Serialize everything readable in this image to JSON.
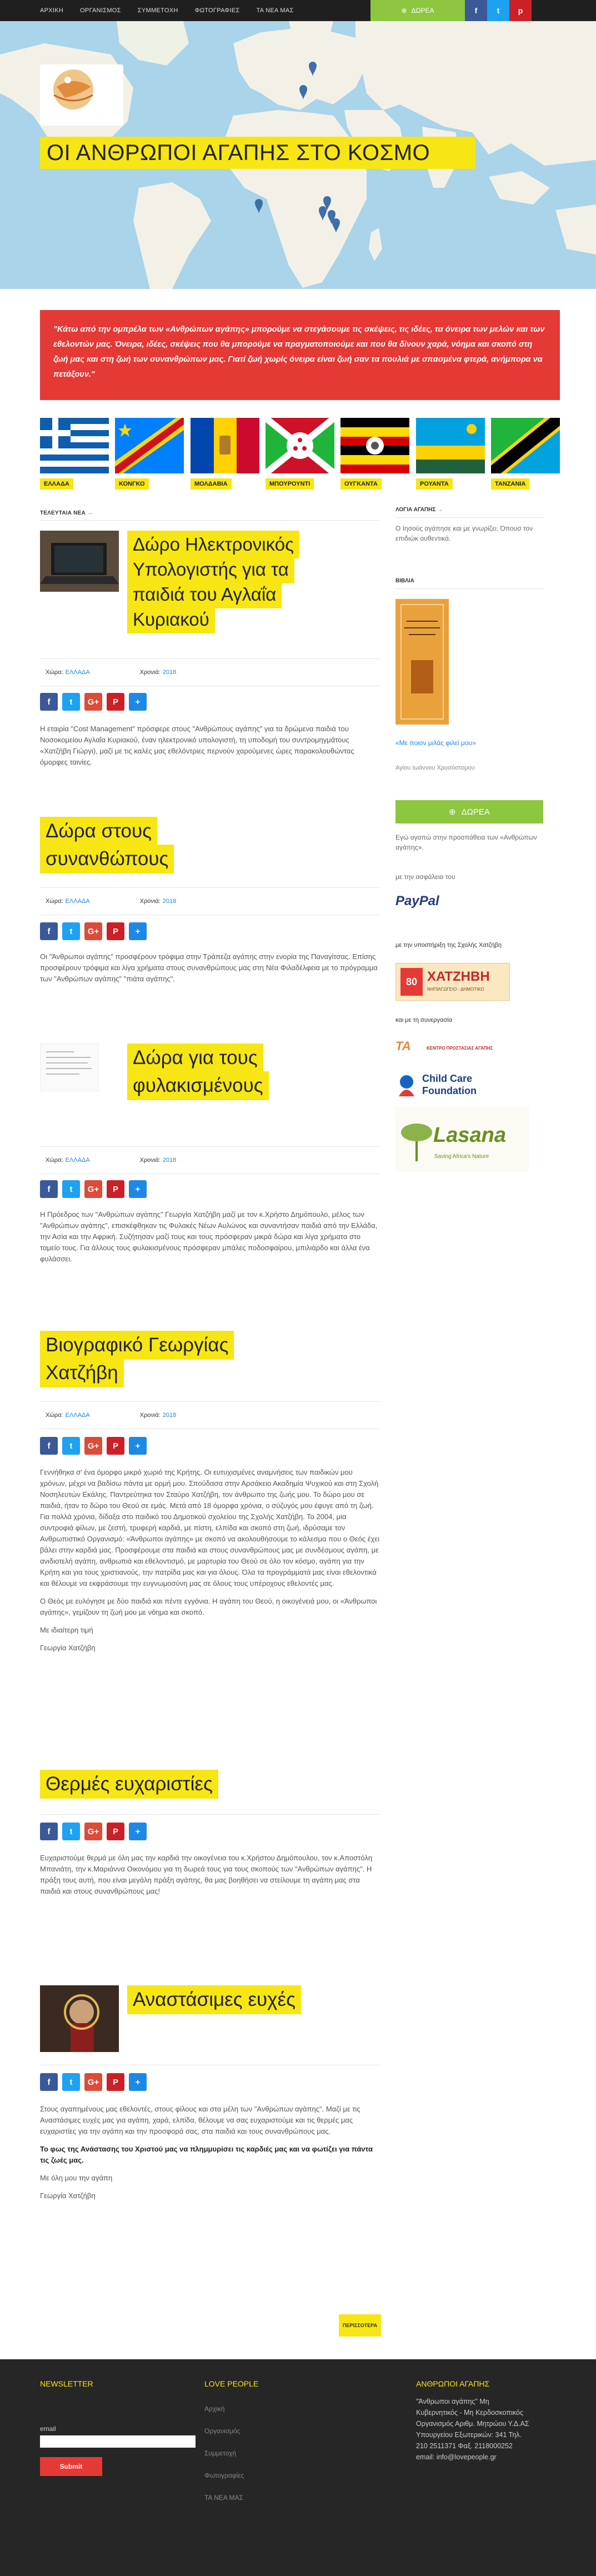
{
  "nav": {
    "items": [
      "ΑΡΧΙΚΗ",
      "ΟΡΓΑΝΙΣΜΟΣ",
      "ΣΥΜΜΕΤΟΧΗ",
      "ΦΩΤΟΓΡΑΦΙΕΣ",
      "ΤΑ ΝΕΑ ΜΑΣ"
    ],
    "donate_label": "ΔΩΡΕΑ"
  },
  "hero": {
    "title": "ΟΙ ΑΝΘΡΩΠΟΙ ΑΓΑΠΗΣ ΣΤΟ ΚΟΣΜΟ"
  },
  "quote": "\"Κάτω από την ομπρέλα των «Ανθρώπων αγάπης» μπορούμε να στεγάσουμε τις σκέψεις, τις ιδέες, τα όνειρα των μελών και των εθελοντών μας. Όνειρα, ιδέες, σκέψεις που θα μπορούμε να πραγματοποιούμε και που θα δίνουν χαρά, νόημα και σκοπό στη ζωή μας και στη ζωή των συνανθρώπων μας. Γιατί ζωή χωρίς όνειρα είναι ζωή σαν τα πουλιά με σπασμένα φτερά, ανήμπορα να πετάξουν.\"",
  "flags": [
    "ΕΛΛΑΔΑ",
    "ΚΟΝΓΚΟ",
    "ΜΟΛΔΑΒΙΑ",
    "ΜΠΟΥΡΟΥΝΤΙ",
    "ΟΥΓΚΑΝΤΑ",
    "ΡΟΥΑΝΤΑ",
    "ΤΑΝΖΑΝΙΑ"
  ],
  "main": {
    "section_title": "ΤΕΛΕΥΤΑΙΑ ΝΕΑ",
    "country_label": "Χώρα:",
    "year_label": "Χρονιά:",
    "posts": [
      {
        "title_lines": [
          "Δώρο Ηλεκτρονικός",
          "Υπολογιστής για τα",
          "παιδιά του Αγλαΐα",
          "Κυριακού"
        ],
        "country": "ΕΛΛΑΔΑ",
        "year": "2018",
        "body": [
          "Η εταιρία \"Cost Management\" πρόσφερε στους \"Ανθρώπους αγάπης\" για τα δρώμενα παιδιά του Νοσοκομείου Αγλαΐα Κυριακού, έναν ηλεκτρονικό υπολογιστή, τη υποδομή του συντρομηγμάτους «Χατζήβη Γιώργι), μαζί με τις καλές μας εθελόντριες περνούν χαρούμενες ώρες παρακολουθώντας όμορφες ταινίες."
        ]
      },
      {
        "title_lines": [
          "Δώρα στους",
          "συνανθώπους"
        ],
        "country": "ΕΛΛΑΔΑ",
        "year": "2018",
        "body": [
          "Οι \"Άνθρωποι αγάπης\" προσφέρουν τρόφιμα στην Τράπεζα αγάπης στην ενορία της Παναγίτσας. Επίσης προσφέρουν τρόφιμα και λίγα χρήματα στους συνανθρώπους μας στη Νέα Φιλαδέλφεια με το πρόγραμμα των \"Ανθρώπων αγάπης\" \"πιάτα αγάπης\"."
        ]
      },
      {
        "title_lines": [
          "Δώρα για τους",
          "φυλακισμένους"
        ],
        "country": "ΕΛΛΑΔΑ",
        "year": "2018",
        "body": [
          "Η Πρόεδρος των \"Ανθρώπων αγάπης\" Γεωργία Χατζήβη μαζί με τον κ.Χρήστο Δημόπουλο, μέλος των \"Ανθρώπων αγάπης\", επισκέφθηκαν τις Φυλακές Νέων Αυλώνος και συναντήσαν παιδιά από την Ελλάδα, την Ασία και την Αφρική. Συζήτησαν μαζί τους και τους πρόσφεραν μικρά δώρα και λίγα χρήματα στο ταμείο τους. Για άλλους τους φυλακισμένους πρόσφεραν μπάλες ποδοσφαίρου, μπιλιάρδο και άλλα ένα φυλάσσει."
        ]
      },
      {
        "title_lines": [
          "Βιογραφικό Γεωργίας",
          "Χατζήβη"
        ],
        "country": "ΕΛΛΑΔΑ",
        "year": "2018",
        "body": [
          "Γεννήθηκα σ' ένα όμορφο μικρό χωριό της Κρήτης. Οι ευτυχισμένες αναμνήσεις των παιδικών μου χρόνων, μέχρι να βαδίσω πάντα με ορμή μου. Σπούδασα στην Αρσάκειο Ακαδημία Ψυχικού και στη Σχολή Νοσηλευτών Εκάλης. Παντρεύτηκα τον Σταύρο Χατζήβη, τον άνθρωπο της ζωής μου. Το δώρο μου σε παιδιά, ήταν το δώρο του Θεού σε εμάς. Μετά από 18 όμορφα χρόνια, ο σύζυγός μου έφυγε από τη ζωή. Για πολλά χρόνια, δίδαξα στο παιδικό του Δημοτικού σχολείου της Σχολής Χατζήβη. Το 2004, μια συντροφιά φίλων, με ζεστή, τρυφερή καρδιά, με πίστη, ελπίδα και σκοπό στη ζωή, ιδρύσαμε τον Ανθρωπιστικό Οργανισμό: «Άνθρωποι αγάπης» με σκοπό να ακολουθήσουμε το κάλεσμα που ο Θεός έχει βάλει στην καρδιά μας. Προσφέρουμε στα παιδιά και στους συνανθρώπους μας με συνδέσμους αγάπη, με ανιδιοτελή αγάπη, ανθρωπιά και εθελοντισμό, με μαρτυρία του Θεού σε όλο τον κόσμο, αγάπη για την Κρήτη και για τους χριστιανούς, την πατρίδα μας και για όλους. Όλα τα προγράμματά μας είναι εθελοντικά και θέλουμε να εκφράσουμε την ευγνωμοσύνη μας σε όλους τους υπέροχους εθελοντές μας.",
          "Ο Θεός με ευλόγησε με δύο παιδιά και πέντε εγγόνια. Η αγάπη του Θεού, η οικογένειά μου, οι «Άνθρωποι αγάπης», γεμίζουν τη ζωή μου με νόημα και σκοπό.",
          "Με ιδιαίτερη τιμή",
          "Γεωργία Χατζήβη"
        ]
      },
      {
        "title_lines": [
          "Θερμές ευχαριστίες"
        ],
        "country": "",
        "year": "",
        "body": [
          "Ευχαριστούμε θερμά με όλη μας την καρδιά την οικογένεια του κ.Χρήστου Δημόπουλου, τον κ.Αποστόλη Μπανιάτη, την κ.Μαριάννα Οικονόμου για τη δωρεά τους για τους σκοπούς των \"Ανθρώπων αγάπης\". Η πράξη τους αυτή, που είναι μεγάλη πράξη αγάπης, θα μας βοηθήσει να στείλουμε τη αγάπη μας στα παιδιά και στους συνανθρώπους μας!"
        ]
      },
      {
        "title_lines": [
          "Αναστάσιμες ευχές"
        ],
        "country": "",
        "year": "",
        "body": [
          "Στους αγαπημένους μας εθελοντές, στους φίλους και στα μέλη των \"Ανθρώπων αγάπης\". Μαζί με τις Αναστάσιμες ευχές μας για αγάπη, χαρά, ελπίδα, θέλουμε να σας ευχαριστούμε και τις θερμές μας ευχαριστίες για την αγάπη και την προσφορά σας, στα παιδιά και τους συνανθρώπους μας.",
          "Το φως της Ανάστασης του Χριστού μας να πλημμυρίσει τις καρδιές μας και να φωτίζει για πάντα τις ζωές μας.",
          "Με όλη μου την αγάπη",
          "Γεωργία Χατζήβη"
        ]
      }
    ],
    "older_label": "ΠΕΡΙΣΣΟΤΕΡΑ"
  },
  "sidebar": {
    "logia_title": "ΛΟΓΙΑ ΑΓΑΠΗΣ",
    "logia_text": "Ο Ιησούς αγάπησε και με γνωρίζει. Όπουσ τον επιδιώκ αυθεντικά.",
    "vivlia_title": "ΒΙΒΛΙΑ",
    "book_link": "«Με ποιον μιλάς φιλεί μου»",
    "book_author": "Αγίου Ιωάννου Χρυσόστομου",
    "donate_label": "ΔΩΡΕΑ",
    "donate_text": "Εγώ αγαπώ στην προσπάθεια των «Ανθρώπων αγάπης».",
    "paypal_text": "με την ασφάλεια του",
    "paypal": "PayPal",
    "support_title": "με την υποστήριξη της Σχολής Χατζήβη",
    "school_logo": "ΧΑΤΖΗΒΗ",
    "school_sub": "ΝΗΠΙΑΓΩΓΕΙΟ - ΔΗΜΟΤΙΚΟ",
    "coop_title": "και με τη συνεργασία",
    "partner1": "ΚΕΝΤΡΟ ΠΡΟΣΤΑΣΙΑΣ ΑΓΑΠΗΣ",
    "partner2_a": "Child Care",
    "partner2_b": "Foundation",
    "partner3": "Lasana",
    "partner3_sub": "Saving Africa's Nature"
  },
  "footer": {
    "newsletter_title": "NEWSLETTER",
    "email_label": "email",
    "submit_label": "Submit",
    "col2_title": "LOVE PEOPLE",
    "col2_links": [
      "Αρχική",
      "Οργανισμός",
      "Συμμετοχή",
      "Φωτογραφίες",
      "ΤΑ ΝΕΑ ΜΑΣ"
    ],
    "col3_title": "ΑΝΘΡΩΠΟΙ ΑΓΑΠΗΣ",
    "col3_lines": [
      "\"Άνθρωποι αγάπης\" Μη",
      "Κυβερνητικός - Μη Κερδοσκοπικός",
      "Οργανισμός Αριθμ. Μητρώου Υ.Δ.ΑΣ",
      "Υπουργείου Εξωτερικών: 341 Τηλ.",
      "210 2511371 Φαξ. 2118000252",
      "email: info@lovepeople.gr"
    ]
  },
  "colors": {
    "accent_yellow": "#f7e613",
    "donate_green": "#8dc63f",
    "quote_red": "#e53935",
    "link_blue": "#1e88e5"
  }
}
